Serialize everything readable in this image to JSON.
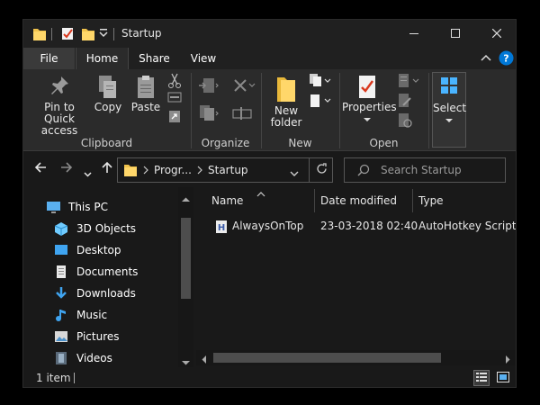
{
  "window": {
    "title": "Startup",
    "accent_color": "#0078d7",
    "background_color": "#191919"
  },
  "tabs": [
    {
      "label": "File"
    },
    {
      "label": "Home"
    },
    {
      "label": "Share"
    },
    {
      "label": "View"
    }
  ],
  "ribbon": {
    "clipboard": {
      "pin_label_1": "Pin to Quick",
      "pin_label_2": "access",
      "copy_label": "Copy",
      "paste_label": "Paste",
      "group_label": "Clipboard"
    },
    "organize": {
      "group_label": "Organize"
    },
    "new": {
      "new_folder_label_1": "New",
      "new_folder_label_2": "folder",
      "group_label": "New"
    },
    "open": {
      "properties_label": "Properties",
      "group_label": "Open"
    },
    "select": {
      "select_label": "Select"
    }
  },
  "address": {
    "segments": [
      "Progr...",
      "Startup"
    ]
  },
  "search": {
    "placeholder": "Search Startup"
  },
  "nav": {
    "items": [
      {
        "label": "This PC",
        "icon": "computer-icon"
      },
      {
        "label": "3D Objects",
        "icon": "cube-icon"
      },
      {
        "label": "Desktop",
        "icon": "desktop-icon"
      },
      {
        "label": "Documents",
        "icon": "document-icon"
      },
      {
        "label": "Downloads",
        "icon": "download-arrow-icon"
      },
      {
        "label": "Music",
        "icon": "music-note-icon"
      },
      {
        "label": "Pictures",
        "icon": "picture-icon"
      },
      {
        "label": "Videos",
        "icon": "film-icon"
      }
    ]
  },
  "files": {
    "columns": [
      "Name",
      "Date modified",
      "Type"
    ],
    "rows": [
      {
        "name": "AlwaysOnTop",
        "date_modified": "23-03-2018 02:40",
        "type": "AutoHotkey Script",
        "icon": "autohotkey-icon"
      }
    ]
  },
  "status": {
    "item_count": "1 item"
  }
}
